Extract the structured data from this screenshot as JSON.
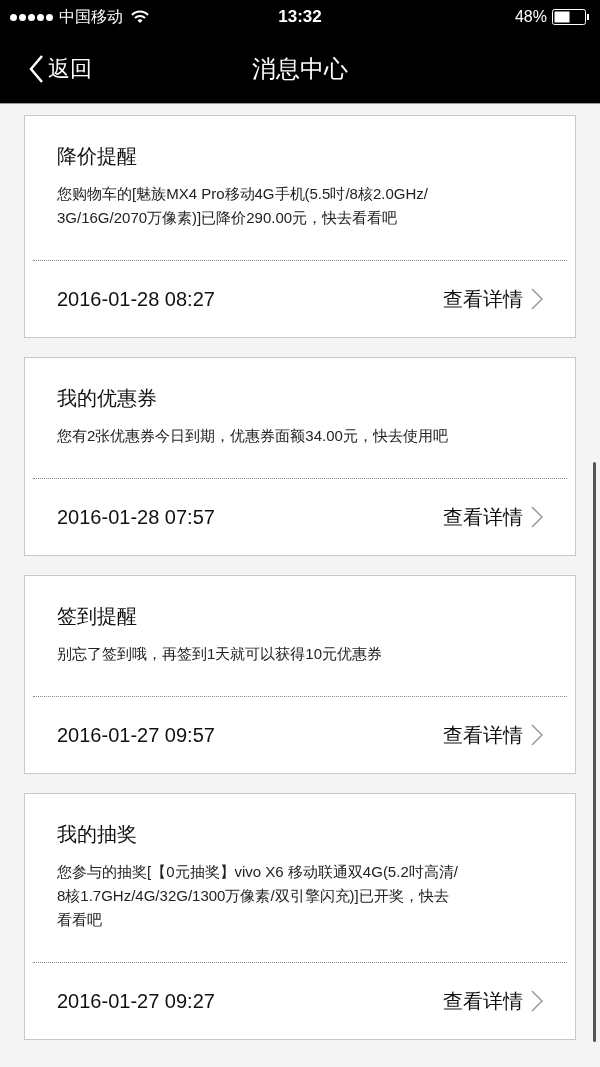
{
  "status_bar": {
    "carrier": "中国移动",
    "time": "13:32",
    "battery": "48%"
  },
  "nav": {
    "back": "返回",
    "title": "消息中心"
  },
  "messages": [
    {
      "title": "降价提醒",
      "body_lines": [
        "您购物车的[魅族MX4 Pro移动4G手机(5.5吋/8核2.0GHz/",
        "3G/16G/2070万像素)]已降价290.00元，快去看看吧"
      ],
      "time": "2016-01-28 08:27",
      "link": "查看详情"
    },
    {
      "title": "我的优惠券",
      "body_lines": [
        "您有2张优惠券今日到期，优惠券面额34.00元，快去使用吧"
      ],
      "time": "2016-01-28 07:57",
      "link": "查看详情"
    },
    {
      "title": "签到提醒",
      "body_lines": [
        "别忘了签到哦，再签到1天就可以获得10元优惠券"
      ],
      "time": "2016-01-27 09:57",
      "link": "查看详情"
    },
    {
      "title": "我的抽奖",
      "body_lines": [
        "您参与的抽奖[【0元抽奖】vivo X6 移动联通双4G(5.2吋高清/",
        "8核1.7GHz/4G/32G/1300万像素/双引擎闪充)]已开奖，快去",
        "看看吧"
      ],
      "time": "2016-01-27 09:27",
      "link": "查看详情"
    }
  ]
}
